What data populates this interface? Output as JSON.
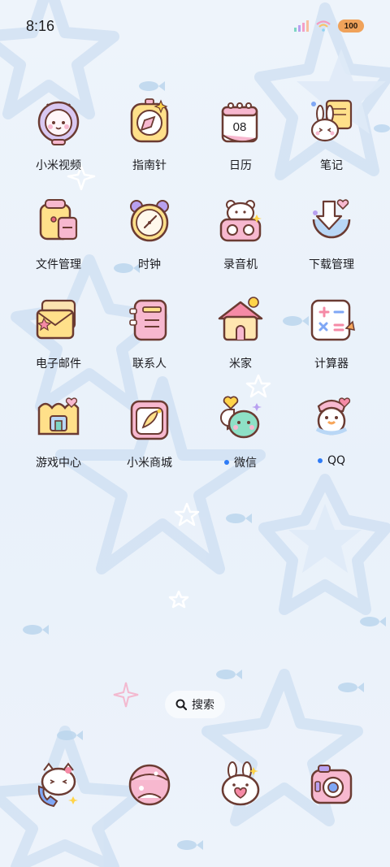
{
  "status_bar": {
    "time": "8:16",
    "battery": "100"
  },
  "apps": [
    {
      "label": "小米视频",
      "icon": "astronaut-cat-icon"
    },
    {
      "label": "指南针",
      "icon": "compass-icon"
    },
    {
      "label": "日历",
      "icon": "calendar-icon",
      "date": "08"
    },
    {
      "label": "笔记",
      "icon": "notes-bunny-icon"
    },
    {
      "label": "文件管理",
      "icon": "folder-bag-icon"
    },
    {
      "label": "时钟",
      "icon": "clock-icon"
    },
    {
      "label": "录音机",
      "icon": "recorder-bear-icon"
    },
    {
      "label": "下载管理",
      "icon": "download-icon"
    },
    {
      "label": "电子邮件",
      "icon": "mail-icon"
    },
    {
      "label": "联系人",
      "icon": "contacts-book-icon"
    },
    {
      "label": "米家",
      "icon": "house-icon"
    },
    {
      "label": "计算器",
      "icon": "calculator-icon"
    },
    {
      "label": "游戏中心",
      "icon": "game-castle-icon"
    },
    {
      "label": "小米商城",
      "icon": "store-bag-icon"
    },
    {
      "label": "微信",
      "icon": "wechat-bubble-icon",
      "new_dot": true
    },
    {
      "label": "QQ",
      "icon": "qq-penguin-icon",
      "new_dot": true
    }
  ],
  "search": {
    "label": "搜索",
    "icon": "search-icon"
  },
  "dock": [
    {
      "icon": "phone-kitty-icon"
    },
    {
      "icon": "message-planet-icon"
    },
    {
      "icon": "browser-bunny-icon"
    },
    {
      "icon": "camera-icon"
    }
  ],
  "colors": {
    "accent_dot": "#2f7cf6",
    "battery": "#f0a25a",
    "outline": "#6b3b32",
    "pink": "#f7b8cf",
    "yellow": "#ffe08a"
  }
}
